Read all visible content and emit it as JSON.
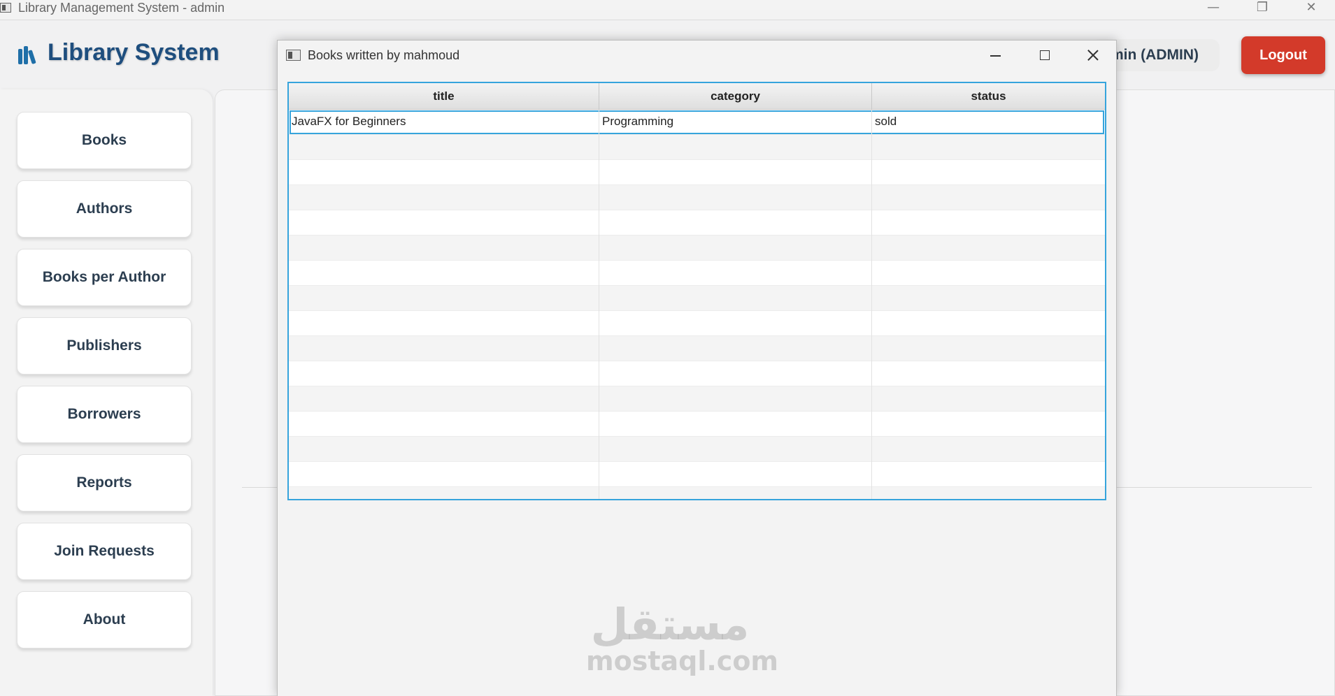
{
  "window": {
    "title": "Library Management System - admin",
    "minimize_glyph": "—",
    "maximize_glyph": "❐",
    "close_glyph": "✕"
  },
  "header": {
    "brand": "Library System",
    "brand_icon": "books-icon",
    "user_label": "min (ADMIN)",
    "logout_label": "Logout",
    "logout_color": "#d33a2a",
    "brand_color": "#1e4e7e"
  },
  "sidebar": {
    "items": [
      {
        "label": "Books"
      },
      {
        "label": "Authors"
      },
      {
        "label": "Books per Author"
      },
      {
        "label": "Publishers"
      },
      {
        "label": "Borrowers"
      },
      {
        "label": "Reports"
      },
      {
        "label": "Join Requests"
      },
      {
        "label": "About"
      }
    ]
  },
  "dialog": {
    "title": "Books written by mahmoud",
    "table": {
      "columns": [
        "title",
        "category",
        "status"
      ],
      "rows": [
        [
          "JavaFX for Beginners",
          "Programming",
          "sold"
        ]
      ],
      "accent": "#36a4dc"
    }
  },
  "watermark": {
    "arabic": "مستقل",
    "latin": "mostaql.com"
  }
}
